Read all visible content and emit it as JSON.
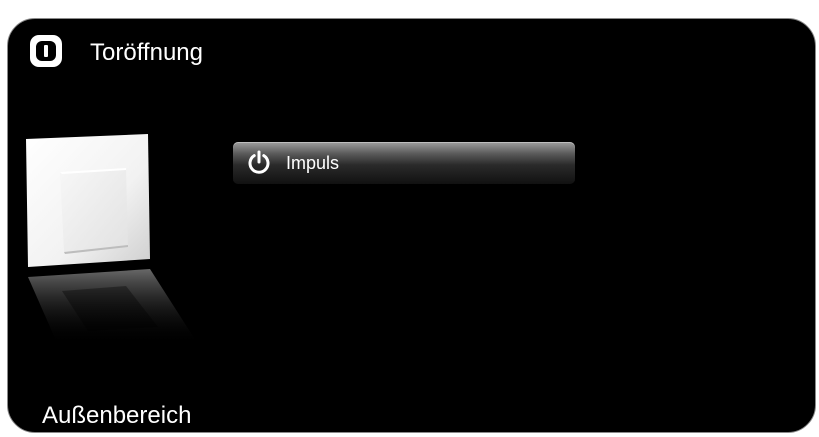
{
  "header": {
    "title": "Toröffnung",
    "icon": "door-status-icon"
  },
  "device": {
    "image": "light-switch-icon"
  },
  "actions": {
    "impuls_label": "Impuls",
    "impuls_icon": "power-icon"
  },
  "footer": {
    "area_label": "Außenbereich"
  },
  "colors": {
    "background": "#000000",
    "text": "#ffffff",
    "border": "#8a8a8a"
  }
}
